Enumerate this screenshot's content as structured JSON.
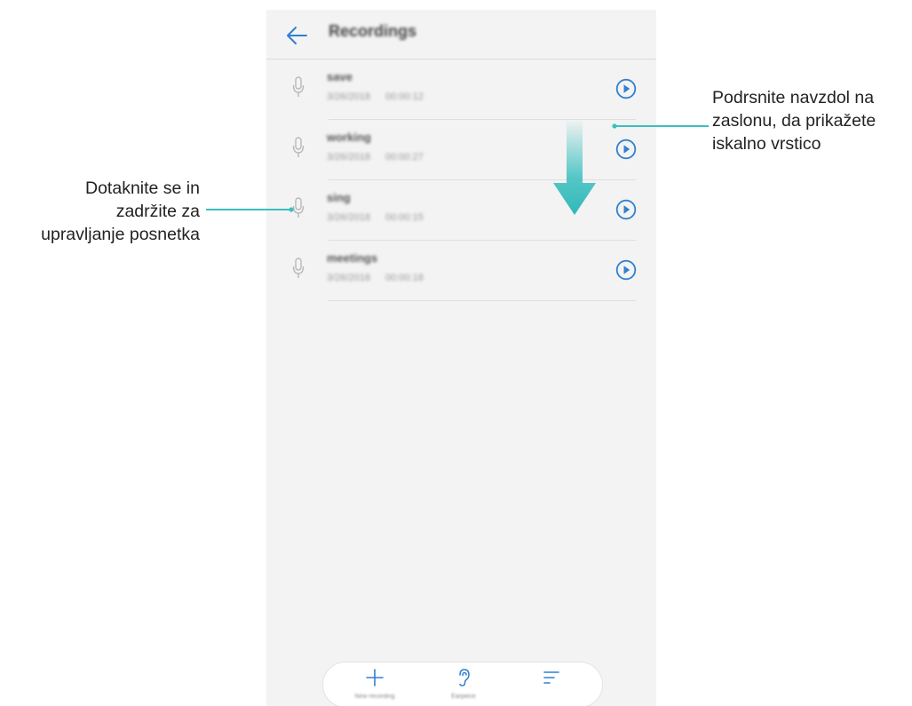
{
  "app": {
    "title": "Recordings"
  },
  "recordings": [
    {
      "name": "save",
      "date": "3/26/2018",
      "duration": "00:00:12"
    },
    {
      "name": "working",
      "date": "3/26/2018",
      "duration": "00:00:27"
    },
    {
      "name": "sing",
      "date": "3/26/2018",
      "duration": "00:00:15"
    },
    {
      "name": "meetings",
      "date": "3/26/2018",
      "duration": "00:00:18"
    }
  ],
  "bottom_bar": {
    "new_recording_label": "New recording",
    "earpiece_label": "Earpiece",
    "sort_label": ""
  },
  "callouts": {
    "left": [
      "Dotaknite se in",
      "zadržite za",
      "upravljanje posnetka"
    ],
    "right": [
      "Podrsnite navzdol na",
      "zaslonu, da prikažete",
      "iskalno vrstico"
    ]
  },
  "colors": {
    "accent": "#2f80d1",
    "annotation": "#3bbfbf",
    "mic": "#b9b9b9",
    "screen_bg": "#f3f3f3"
  },
  "icons": {
    "back": "arrow-left-icon",
    "mic": "microphone-icon",
    "play": "play-circle-icon",
    "new": "plus-icon",
    "earpiece": "ear-icon",
    "sort": "sort-lines-icon",
    "swipe": "arrow-down-icon"
  }
}
